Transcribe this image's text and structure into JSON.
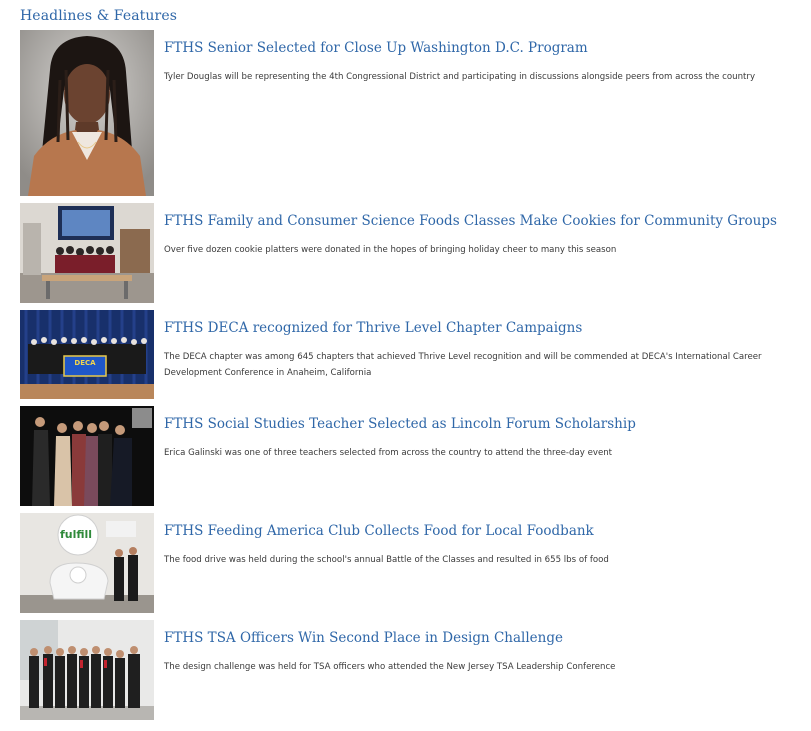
{
  "section": {
    "title": "Headlines & Features"
  },
  "articles": [
    {
      "headline": "FTHS Senior Selected for Close Up Washington D.C. Program",
      "description": "Tyler Douglas will be representing the 4th Congressional District and participating in discussions alongside peers from across the country",
      "image": "student-portrait-photo"
    },
    {
      "headline": "FTHS Family and Consumer Science Foods Classes Make Cookies for Community Groups",
      "description": "Over five dozen cookie platters were donated in the hopes of bringing holiday cheer to many this season",
      "image": "classroom-group-photo"
    },
    {
      "headline": "FTHS DECA recognized for Thrive Level Chapter Campaigns",
      "description": "The DECA chapter was among 645 chapters that achieved Thrive Level recognition and will be commended at DECA's International Career Development Conference in Anaheim, California",
      "image": "deca-group-banner-photo",
      "banner_text": "DECA"
    },
    {
      "headline": "FTHS Social Studies Teacher Selected as Lincoln Forum Scholarship",
      "description": "Erica Galinski was one of three teachers selected from across the country to attend the three-day event",
      "image": "teachers-group-photo"
    },
    {
      "headline": "FTHS Feeding America Club Collects Food for Local Foodbank",
      "description": "The food drive was held during the school's annual Battle of the Classes and resulted in 655 lbs of food",
      "image": "fulfill-foodbank-photo",
      "sign_text": "fulfill"
    },
    {
      "headline": "FTHS TSA Officers Win Second Place in Design Challenge",
      "description": "The design challenge was held for TSA officers who attended the New Jersey TSA Leadership Conference",
      "image": "tsa-officers-photo"
    }
  ]
}
